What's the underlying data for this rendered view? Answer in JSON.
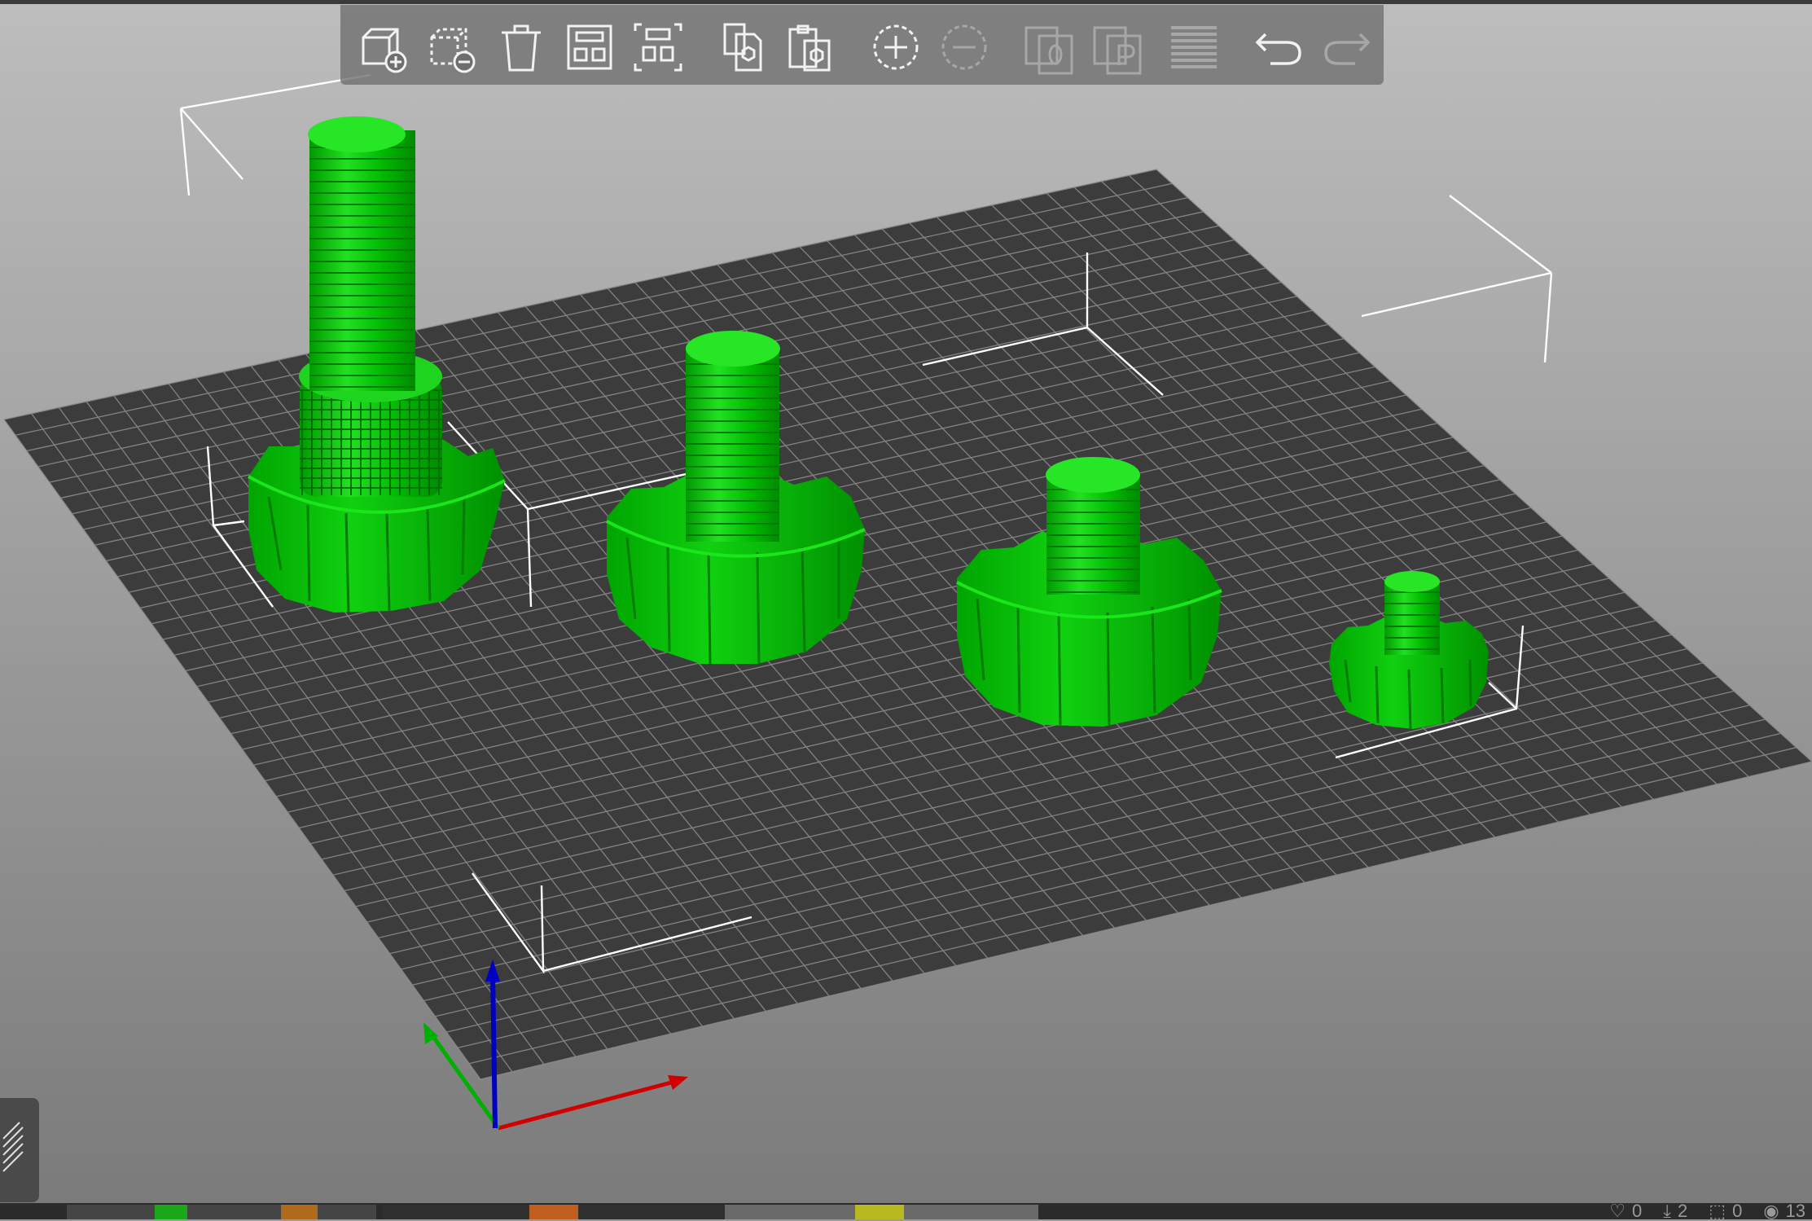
{
  "toolbar": {
    "items": [
      {
        "icon": "add-object-icon",
        "enabled": true
      },
      {
        "icon": "remove-object-icon",
        "enabled": true
      },
      {
        "icon": "delete-all-icon",
        "enabled": true
      },
      {
        "icon": "arrange-icon",
        "enabled": true
      },
      {
        "icon": "arrange-selection-icon",
        "enabled": true
      },
      {
        "icon": "copy-icon",
        "enabled": true
      },
      {
        "icon": "paste-icon",
        "enabled": true
      },
      {
        "icon": "add-instance-icon",
        "enabled": true
      },
      {
        "icon": "remove-instance-icon",
        "enabled": false
      },
      {
        "icon": "split-to-objects-icon",
        "enabled": false
      },
      {
        "icon": "split-to-parts-icon",
        "enabled": false
      },
      {
        "icon": "variable-layer-height-icon",
        "enabled": false
      },
      {
        "icon": "undo-icon",
        "enabled": true
      },
      {
        "icon": "redo-icon",
        "enabled": false
      }
    ]
  },
  "scene": {
    "objects": [
      {
        "name": "knurled-knob-tall",
        "color": "#00c800"
      },
      {
        "name": "knob-medium",
        "color": "#00c800"
      },
      {
        "name": "knob-short",
        "color": "#00c800"
      },
      {
        "name": "knob-small",
        "color": "#00c800"
      }
    ],
    "bed_color": "#3c3c3c",
    "grid_color": "#8a8a8a",
    "axis_colors": {
      "x": "#d00000",
      "y": "#00b000",
      "z": "#0000c0"
    }
  },
  "status": {
    "stats": [
      {
        "icon": "heart-icon",
        "value": "0"
      },
      {
        "icon": "download-icon",
        "value": "2"
      },
      {
        "icon": "cube-icon",
        "value": "0"
      },
      {
        "icon": "eye-icon",
        "value": "13"
      }
    ]
  }
}
